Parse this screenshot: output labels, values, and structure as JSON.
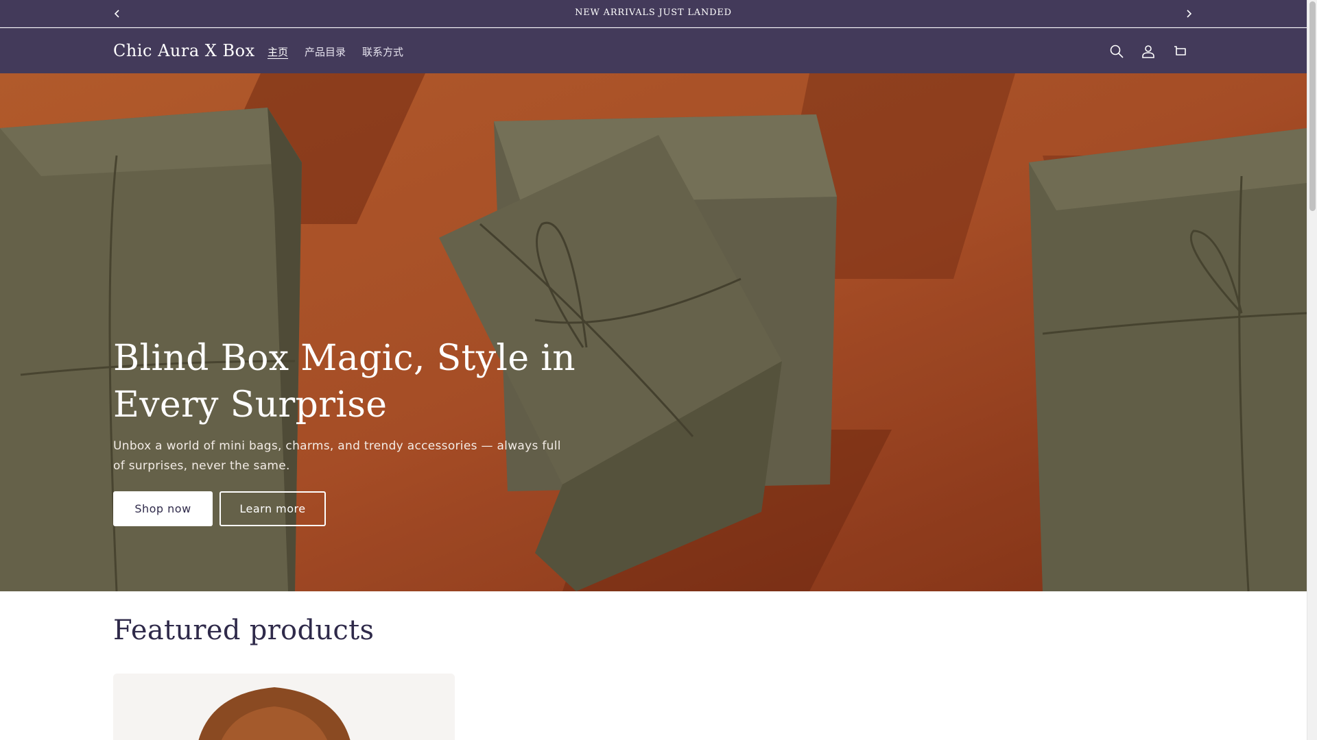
{
  "announcement": {
    "text": "NEW ARRIVALS JUST LANDED",
    "prev_icon": "chevron-left-icon",
    "next_icon": "chevron-right-icon"
  },
  "header": {
    "logo": "Chic Aura X Box",
    "nav": [
      {
        "label": "主页",
        "active": true
      },
      {
        "label": "产品目录",
        "active": false
      },
      {
        "label": "联系方式",
        "active": false
      }
    ],
    "icons": [
      "search-icon",
      "account-icon",
      "cart-icon"
    ]
  },
  "hero": {
    "title": "Blind Box Magic, Style in Every Surprise",
    "subtitle": "Unbox a world of mini bags, charms, and trendy accessories — always full of surprises, never the same.",
    "primary_button": "Shop now",
    "secondary_button": "Learn more"
  },
  "featured": {
    "title": "Featured products"
  },
  "colors": {
    "header_bg": "#433a5a",
    "hero_bg": "#b4542a",
    "box_olive": "#6e6a50",
    "heading_text": "#2f2a4a"
  }
}
